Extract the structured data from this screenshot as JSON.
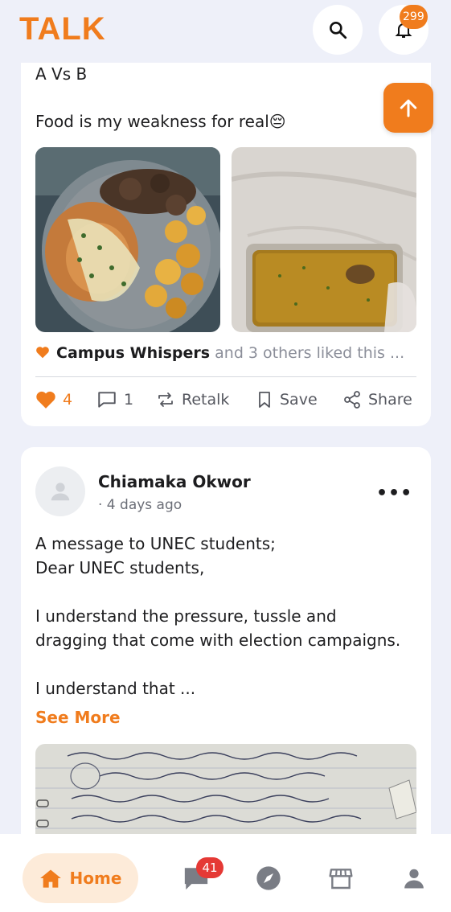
{
  "app": {
    "logo": "TALK",
    "notification_count": "299"
  },
  "post1": {
    "title_line": "A Vs B",
    "caption": "Food is my weakness for real😔",
    "liked_by": "Campus Whispers",
    "liked_suffix": "and 3 others liked this ...",
    "like_count": "4",
    "comment_count": "1",
    "retalk_label": "Retalk",
    "save_label": "Save",
    "share_label": "Share"
  },
  "post2": {
    "author": "Chiamaka Okwor",
    "time": "· 4 days ago",
    "lines": [
      "A message to UNEC students;",
      "Dear UNEC students,",
      "I understand the pressure, tussle and",
      "dragging that come with election campaigns.",
      "I understand that ..."
    ],
    "see_more": "See More"
  },
  "nav": {
    "home_label": "Home",
    "messages_badge": "41"
  },
  "colors": {
    "accent": "#f07c1d",
    "badge_red": "#e53935",
    "background": "#eef0f9"
  }
}
